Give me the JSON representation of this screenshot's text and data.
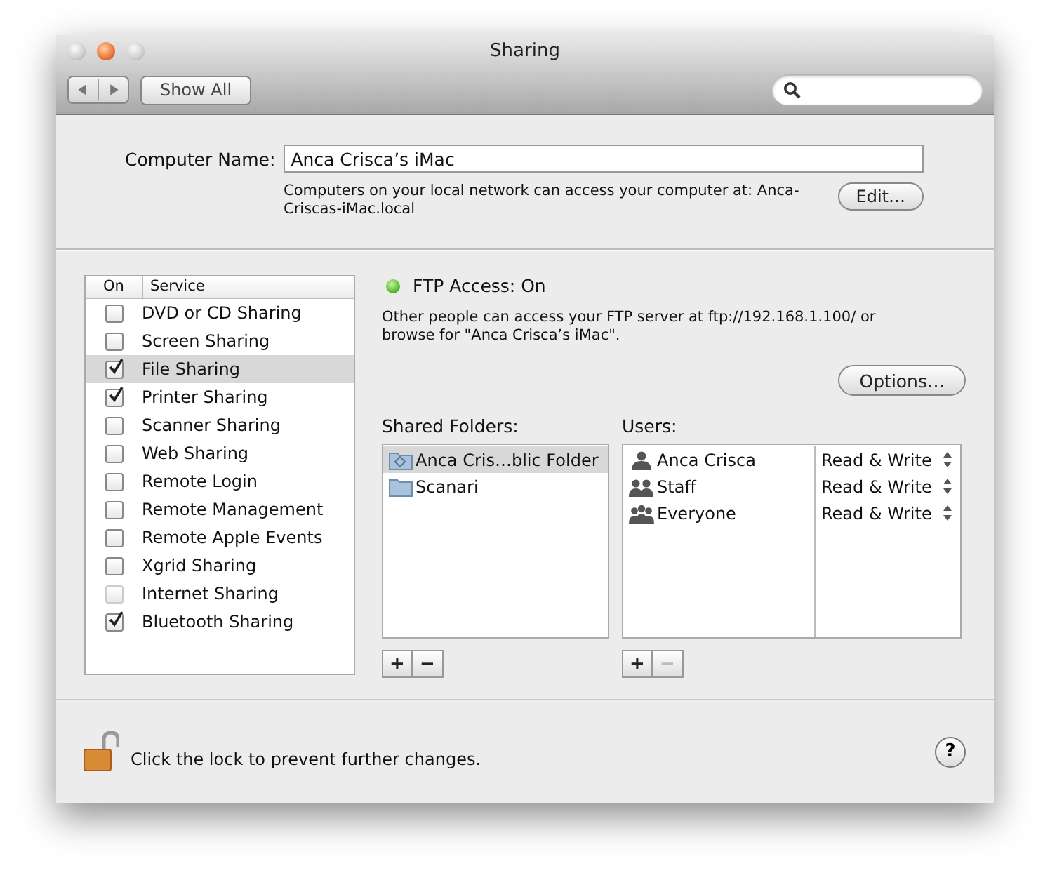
{
  "window": {
    "title": "Sharing"
  },
  "toolbar": {
    "show_all": "Show All"
  },
  "computer_name": {
    "label": "Computer Name:",
    "value": "Anca Crisca’s iMac",
    "note": "Computers on your local network can access your computer at: Anca-Criscas-iMac.local",
    "edit_button": "Edit…"
  },
  "services": {
    "columns": [
      "On",
      "Service"
    ],
    "items": [
      {
        "name": "DVD or CD Sharing",
        "checked": false,
        "selected": false,
        "disabled": false
      },
      {
        "name": "Screen Sharing",
        "checked": false,
        "selected": false,
        "disabled": false
      },
      {
        "name": "File Sharing",
        "checked": true,
        "selected": true,
        "disabled": false
      },
      {
        "name": "Printer Sharing",
        "checked": true,
        "selected": false,
        "disabled": false
      },
      {
        "name": "Scanner Sharing",
        "checked": false,
        "selected": false,
        "disabled": false
      },
      {
        "name": "Web Sharing",
        "checked": false,
        "selected": false,
        "disabled": false
      },
      {
        "name": "Remote Login",
        "checked": false,
        "selected": false,
        "disabled": false
      },
      {
        "name": "Remote Management",
        "checked": false,
        "selected": false,
        "disabled": false
      },
      {
        "name": "Remote Apple Events",
        "checked": false,
        "selected": false,
        "disabled": false
      },
      {
        "name": "Xgrid Sharing",
        "checked": false,
        "selected": false,
        "disabled": false
      },
      {
        "name": "Internet Sharing",
        "checked": false,
        "selected": false,
        "disabled": true
      },
      {
        "name": "Bluetooth Sharing",
        "checked": true,
        "selected": false,
        "disabled": false
      }
    ]
  },
  "status": {
    "label": "FTP Access: On",
    "on": true,
    "description": "Other people can access your FTP server at ftp://192.168.1.100/ or browse for \"Anca Crisca’s iMac\".",
    "options_button": "Options…"
  },
  "shared_folders": {
    "label": "Shared Folders:",
    "items": [
      {
        "name": "Anca Cris…blic Folder",
        "kind": "public",
        "selected": true
      },
      {
        "name": "Scanari",
        "kind": "plain",
        "selected": false
      }
    ],
    "add": "+",
    "remove": "−",
    "remove_disabled": false
  },
  "users": {
    "label": "Users:",
    "items": [
      {
        "name": "Anca Crisca",
        "kind": "user",
        "permission": "Read & Write"
      },
      {
        "name": "Staff",
        "kind": "group",
        "permission": "Read & Write"
      },
      {
        "name": "Everyone",
        "kind": "everyone",
        "permission": "Read & Write"
      }
    ],
    "add": "+",
    "remove": "−",
    "remove_disabled": true
  },
  "footer": {
    "lock_text": "Click the lock to prevent further changes.",
    "locked": false,
    "help": "?"
  }
}
